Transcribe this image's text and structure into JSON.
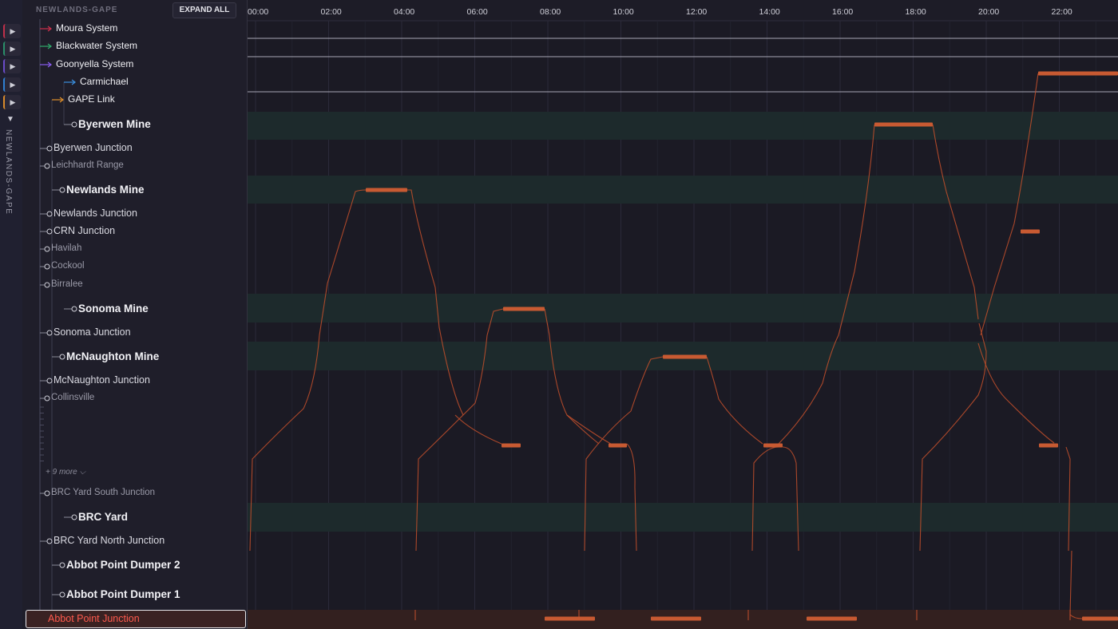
{
  "rail": {
    "buttons": [
      {
        "icon": "play-icon",
        "color": "#c0304a"
      },
      {
        "icon": "play-icon",
        "color": "#2a8f6a"
      },
      {
        "icon": "play-icon",
        "color": "#6a4cc8"
      },
      {
        "icon": "play-icon",
        "color": "#2f7fd0"
      },
      {
        "icon": "play-icon",
        "color": "#d98a2b"
      }
    ],
    "collapse_icon": "chevron-down-icon",
    "label": "NEWLANDS-GAPE"
  },
  "sidebar": {
    "title": "NEWLANDS-GAPE",
    "expand_all": "EXPAND ALL",
    "systems": [
      {
        "label": "Moura System",
        "color": "#d0304d"
      },
      {
        "label": "Blackwater System",
        "color": "#2faa6a"
      },
      {
        "label": "Goonyella System",
        "color": "#8a5cf0"
      },
      {
        "label": "Carmichael",
        "color": "#3b8fe0"
      },
      {
        "label": "GAPE Link",
        "color": "#e0902a"
      }
    ],
    "locations": [
      {
        "label": "Byerwen Mine",
        "kind": "mine"
      },
      {
        "label": "Byerwen Junction",
        "kind": "junction"
      },
      {
        "label": "Leichhardt Range",
        "kind": "small"
      },
      {
        "label": "Newlands Mine",
        "kind": "mine"
      },
      {
        "label": "Newlands Junction",
        "kind": "junction"
      },
      {
        "label": "CRN Junction",
        "kind": "junction"
      },
      {
        "label": "Havilah",
        "kind": "small"
      },
      {
        "label": "Cockool",
        "kind": "small"
      },
      {
        "label": "Birralee",
        "kind": "small"
      },
      {
        "label": "Sonoma Mine",
        "kind": "mine"
      },
      {
        "label": "Sonoma Junction",
        "kind": "junction"
      },
      {
        "label": "McNaughton Mine",
        "kind": "mine"
      },
      {
        "label": "McNaughton Junction",
        "kind": "junction"
      },
      {
        "label": "Collinsville",
        "kind": "small"
      },
      {
        "label": "BRC Yard South Junction",
        "kind": "small"
      },
      {
        "label": "BRC Yard",
        "kind": "mine"
      },
      {
        "label": "BRC Yard North Junction",
        "kind": "junction"
      },
      {
        "label": "Abbot Point Dumper 2",
        "kind": "dumper"
      },
      {
        "label": "Abbot Point Dumper 1",
        "kind": "dumper"
      }
    ],
    "more_label": "+ 9 more",
    "selected": {
      "label": "Abbot Point Junction",
      "color": "#ff5a4e"
    }
  },
  "timeline": {
    "ticks": [
      "00:00",
      "02:00",
      "04:00",
      "06:00",
      "08:00",
      "10:00",
      "12:00",
      "14:00",
      "16:00",
      "18:00",
      "20:00",
      "22:00"
    ],
    "path_color": "#c4502c",
    "dwell_color": "#c85a32"
  }
}
